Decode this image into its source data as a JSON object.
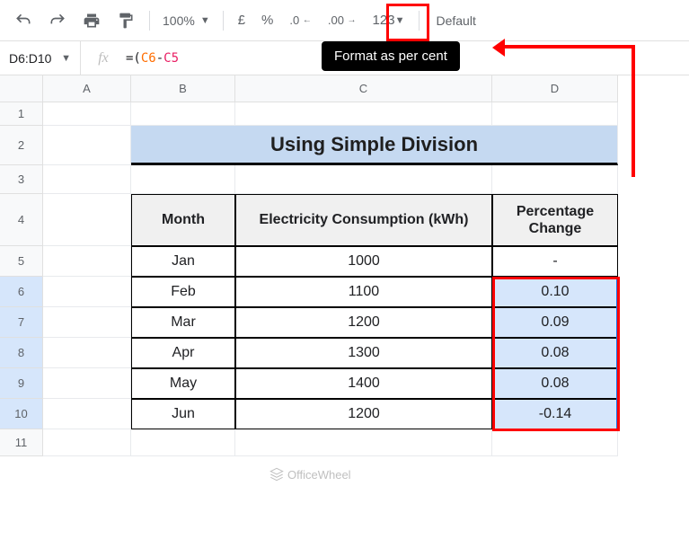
{
  "toolbar": {
    "zoom": "100%",
    "currency": "£",
    "percent": "%",
    "dec_dec": ".0",
    "inc_dec": ".00",
    "numfmt": "123",
    "font": "Default"
  },
  "tooltip": "Format as per cent",
  "namebox": "D6:D10",
  "formula": {
    "prefix": "=(",
    "ref1": "C6",
    "dash": "-",
    "ref2": "C5"
  },
  "columns": [
    "A",
    "B",
    "C",
    "D"
  ],
  "rows": [
    "1",
    "2",
    "3",
    "4",
    "5",
    "6",
    "7",
    "8",
    "9",
    "10",
    "11"
  ],
  "title": "Using Simple Division",
  "headers": {
    "month": "Month",
    "cons": "Electricity Consumption (kWh)",
    "pct": "Percentage Change"
  },
  "data": [
    {
      "month": "Jan",
      "cons": "1000",
      "pct": "-"
    },
    {
      "month": "Feb",
      "cons": "1100",
      "pct": "0.10"
    },
    {
      "month": "Mar",
      "cons": "1200",
      "pct": "0.09"
    },
    {
      "month": "Apr",
      "cons": "1300",
      "pct": "0.08"
    },
    {
      "month": "May",
      "cons": "1400",
      "pct": "0.08"
    },
    {
      "month": "Jun",
      "cons": "1200",
      "pct": "-0.14"
    }
  ],
  "fx_label": "fx",
  "watermark": "OfficeWheel"
}
